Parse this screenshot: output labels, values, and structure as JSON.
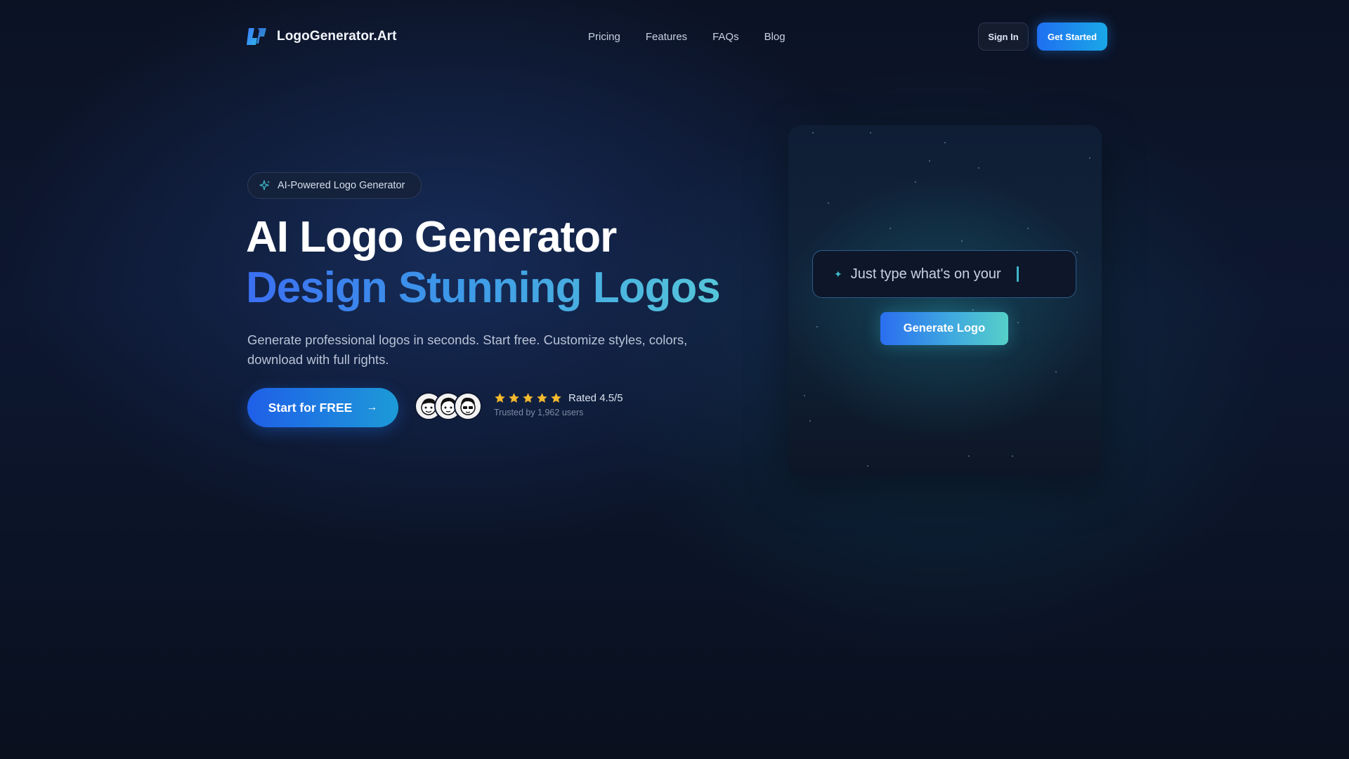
{
  "nav": {
    "brand": "LogoGenerator.Art",
    "links": [
      "Pricing",
      "Features",
      "FAQs",
      "Blog"
    ],
    "sign_in": "Sign In",
    "get_started": "Get Started"
  },
  "hero": {
    "badge": "AI-Powered Logo Generator",
    "title": "AI Logo Generator",
    "title_gradient": "Design Stunning Logos",
    "subtitle": "Generate professional logos in seconds. Start free. Customize styles, colors, download with full rights.",
    "cta": "Start for FREE",
    "cta_icon": "arrow-right-icon",
    "rating_text": "Rated 4.5/5",
    "rating_value": 4.5,
    "stars_shown": 5,
    "trusted": "Trusted by 1,962 users",
    "avatar_count": 3
  },
  "generator": {
    "prompt_text": "Just type what's on your",
    "generate_button": "Generate Logo"
  },
  "colors": {
    "accent_blue": "#1f6ff0",
    "accent_cyan": "#3fb6c9",
    "star_gold": "#f5b92e",
    "background": "#0b1224"
  }
}
